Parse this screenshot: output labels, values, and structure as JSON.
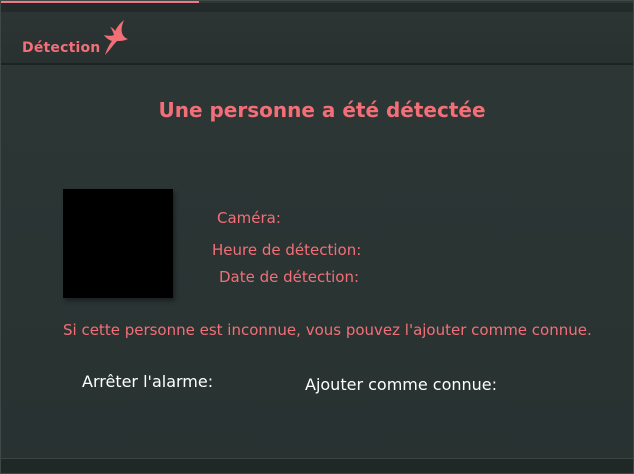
{
  "header": {
    "title": "Détection",
    "logo_icon": "bird-icon"
  },
  "main": {
    "title": "Une personne a été détectée",
    "info": {
      "camera_label": "Caméra:",
      "time_label": "Heure de détection:",
      "date_label": "Date de détection:"
    },
    "message": "Si cette personne est inconnue, vous pouvez l'ajouter comme connue."
  },
  "actions": {
    "stop_alarm": "Arrêter l'alarme:",
    "add_known": "Ajouter comme connue:"
  },
  "colors": {
    "accent": "#f36f78",
    "background": "#2b3534",
    "button_text": "#ffffff"
  }
}
